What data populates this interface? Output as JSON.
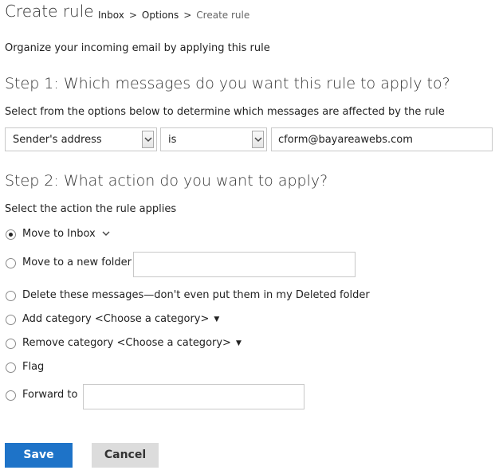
{
  "header": {
    "title": "Create rule",
    "breadcrumb": {
      "items": [
        "Inbox",
        "Options",
        "Create rule"
      ],
      "separator": ">"
    }
  },
  "intro": "Organize your incoming email by applying this rule",
  "step1": {
    "heading": "Step 1: Which messages do you want this rule to apply to?",
    "subtitle": "Select from the options below to determine which messages are affected by the rule",
    "field_select": "Sender's address",
    "operator_select": "is",
    "value": "cform@bayareawebs.com"
  },
  "step2": {
    "heading": "Step 2: What action do you want to apply?",
    "subtitle": "Select the action the rule applies",
    "actions": [
      {
        "label": "Move to Inbox",
        "checked": true
      },
      {
        "label": "Move to a new folder",
        "checked": false,
        "folder_value": ""
      },
      {
        "label": "Delete these messages—don't even put them in my Deleted folder",
        "checked": false
      },
      {
        "label": "Add category",
        "category": "<Choose a category>",
        "checked": false
      },
      {
        "label": "Remove category",
        "category": "<Choose a category>",
        "checked": false
      },
      {
        "label": "Flag",
        "checked": false
      },
      {
        "label": "Forward to",
        "checked": false,
        "forward_value": ""
      }
    ]
  },
  "buttons": {
    "save": "Save",
    "cancel": "Cancel"
  },
  "icons": {
    "dropdown_arrow": "chevron-down-icon",
    "expand": "chevron-down-icon",
    "category_menu": "caret-down-icon"
  },
  "colors": {
    "save_bg": "#1e73c8",
    "cancel_bg": "#dcdcdc"
  }
}
